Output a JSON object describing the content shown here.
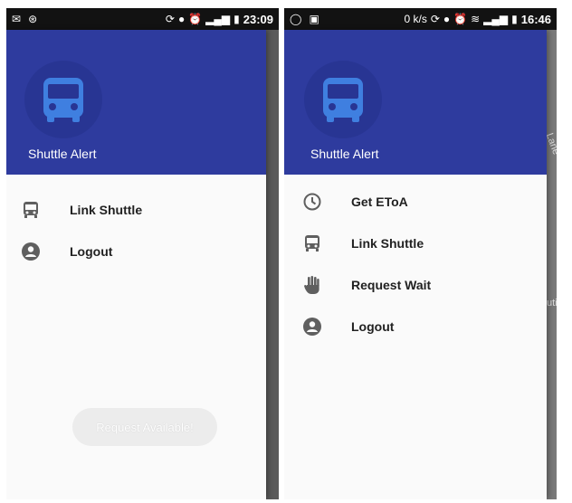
{
  "left_screen": {
    "status_time": "23:09",
    "app_title": "Shuttle Alert",
    "menu": [
      {
        "icon": "bus-icon",
        "label": "Link Shuttle"
      },
      {
        "icon": "account-icon",
        "label": "Logout"
      }
    ],
    "request_button_label": "Request Available!"
  },
  "right_screen": {
    "status_speed": "0 k/s",
    "status_time": "16:46",
    "app_title": "Shuttle Alert",
    "map_labels": [
      "Link Lane",
      "utin"
    ],
    "menu": [
      {
        "icon": "clock-icon",
        "label": "Get EToA"
      },
      {
        "icon": "bus-icon",
        "label": "Link Shuttle"
      },
      {
        "icon": "hand-icon",
        "label": "Request Wait"
      },
      {
        "icon": "account-icon",
        "label": "Logout"
      }
    ]
  },
  "colors": {
    "header": "#2e3b9e",
    "avatar_bg": "#283593",
    "bus_icon": "#3f7fe0",
    "drawer_bg": "#fafafa",
    "statusbar": "#121212"
  }
}
